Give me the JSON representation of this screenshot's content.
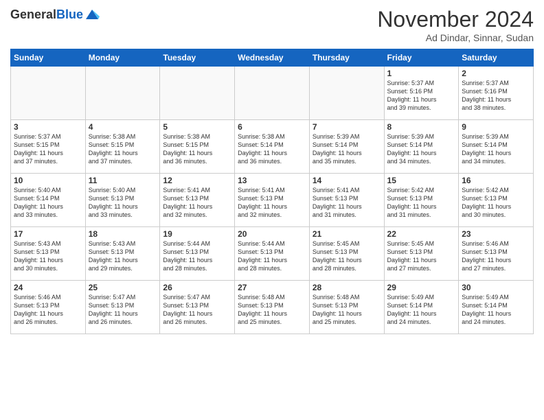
{
  "header": {
    "logo_general": "General",
    "logo_blue": "Blue",
    "month_title": "November 2024",
    "location": "Ad Dindar, Sinnar, Sudan"
  },
  "calendar": {
    "weekdays": [
      "Sunday",
      "Monday",
      "Tuesday",
      "Wednesday",
      "Thursday",
      "Friday",
      "Saturday"
    ],
    "weeks": [
      [
        {
          "day": "",
          "info": ""
        },
        {
          "day": "",
          "info": ""
        },
        {
          "day": "",
          "info": ""
        },
        {
          "day": "",
          "info": ""
        },
        {
          "day": "",
          "info": ""
        },
        {
          "day": "1",
          "info": "Sunrise: 5:37 AM\nSunset: 5:16 PM\nDaylight: 11 hours\nand 39 minutes."
        },
        {
          "day": "2",
          "info": "Sunrise: 5:37 AM\nSunset: 5:16 PM\nDaylight: 11 hours\nand 38 minutes."
        }
      ],
      [
        {
          "day": "3",
          "info": "Sunrise: 5:37 AM\nSunset: 5:15 PM\nDaylight: 11 hours\nand 37 minutes."
        },
        {
          "day": "4",
          "info": "Sunrise: 5:38 AM\nSunset: 5:15 PM\nDaylight: 11 hours\nand 37 minutes."
        },
        {
          "day": "5",
          "info": "Sunrise: 5:38 AM\nSunset: 5:15 PM\nDaylight: 11 hours\nand 36 minutes."
        },
        {
          "day": "6",
          "info": "Sunrise: 5:38 AM\nSunset: 5:14 PM\nDaylight: 11 hours\nand 36 minutes."
        },
        {
          "day": "7",
          "info": "Sunrise: 5:39 AM\nSunset: 5:14 PM\nDaylight: 11 hours\nand 35 minutes."
        },
        {
          "day": "8",
          "info": "Sunrise: 5:39 AM\nSunset: 5:14 PM\nDaylight: 11 hours\nand 34 minutes."
        },
        {
          "day": "9",
          "info": "Sunrise: 5:39 AM\nSunset: 5:14 PM\nDaylight: 11 hours\nand 34 minutes."
        }
      ],
      [
        {
          "day": "10",
          "info": "Sunrise: 5:40 AM\nSunset: 5:14 PM\nDaylight: 11 hours\nand 33 minutes."
        },
        {
          "day": "11",
          "info": "Sunrise: 5:40 AM\nSunset: 5:13 PM\nDaylight: 11 hours\nand 33 minutes."
        },
        {
          "day": "12",
          "info": "Sunrise: 5:41 AM\nSunset: 5:13 PM\nDaylight: 11 hours\nand 32 minutes."
        },
        {
          "day": "13",
          "info": "Sunrise: 5:41 AM\nSunset: 5:13 PM\nDaylight: 11 hours\nand 32 minutes."
        },
        {
          "day": "14",
          "info": "Sunrise: 5:41 AM\nSunset: 5:13 PM\nDaylight: 11 hours\nand 31 minutes."
        },
        {
          "day": "15",
          "info": "Sunrise: 5:42 AM\nSunset: 5:13 PM\nDaylight: 11 hours\nand 31 minutes."
        },
        {
          "day": "16",
          "info": "Sunrise: 5:42 AM\nSunset: 5:13 PM\nDaylight: 11 hours\nand 30 minutes."
        }
      ],
      [
        {
          "day": "17",
          "info": "Sunrise: 5:43 AM\nSunset: 5:13 PM\nDaylight: 11 hours\nand 30 minutes."
        },
        {
          "day": "18",
          "info": "Sunrise: 5:43 AM\nSunset: 5:13 PM\nDaylight: 11 hours\nand 29 minutes."
        },
        {
          "day": "19",
          "info": "Sunrise: 5:44 AM\nSunset: 5:13 PM\nDaylight: 11 hours\nand 28 minutes."
        },
        {
          "day": "20",
          "info": "Sunrise: 5:44 AM\nSunset: 5:13 PM\nDaylight: 11 hours\nand 28 minutes."
        },
        {
          "day": "21",
          "info": "Sunrise: 5:45 AM\nSunset: 5:13 PM\nDaylight: 11 hours\nand 28 minutes."
        },
        {
          "day": "22",
          "info": "Sunrise: 5:45 AM\nSunset: 5:13 PM\nDaylight: 11 hours\nand 27 minutes."
        },
        {
          "day": "23",
          "info": "Sunrise: 5:46 AM\nSunset: 5:13 PM\nDaylight: 11 hours\nand 27 minutes."
        }
      ],
      [
        {
          "day": "24",
          "info": "Sunrise: 5:46 AM\nSunset: 5:13 PM\nDaylight: 11 hours\nand 26 minutes."
        },
        {
          "day": "25",
          "info": "Sunrise: 5:47 AM\nSunset: 5:13 PM\nDaylight: 11 hours\nand 26 minutes."
        },
        {
          "day": "26",
          "info": "Sunrise: 5:47 AM\nSunset: 5:13 PM\nDaylight: 11 hours\nand 26 minutes."
        },
        {
          "day": "27",
          "info": "Sunrise: 5:48 AM\nSunset: 5:13 PM\nDaylight: 11 hours\nand 25 minutes."
        },
        {
          "day": "28",
          "info": "Sunrise: 5:48 AM\nSunset: 5:13 PM\nDaylight: 11 hours\nand 25 minutes."
        },
        {
          "day": "29",
          "info": "Sunrise: 5:49 AM\nSunset: 5:14 PM\nDaylight: 11 hours\nand 24 minutes."
        },
        {
          "day": "30",
          "info": "Sunrise: 5:49 AM\nSunset: 5:14 PM\nDaylight: 11 hours\nand 24 minutes."
        }
      ]
    ]
  }
}
